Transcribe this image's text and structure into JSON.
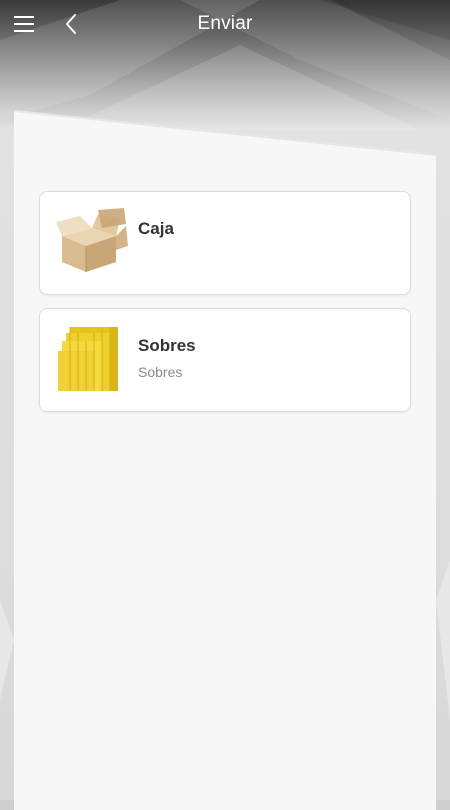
{
  "header": {
    "title": "Enviar",
    "menu_icon": "hamburger-menu-icon",
    "back_icon": "chevron-left-icon"
  },
  "items": [
    {
      "name": "Caja",
      "description": "",
      "image": "cardboard-box-image"
    },
    {
      "name": "Sobres",
      "description": "Sobres",
      "image": "padded-envelopes-image"
    }
  ],
  "colors": {
    "header_text": "#ffffff",
    "card_background": "#ffffff",
    "title_text": "#333333",
    "subtitle_text": "#8a8a8a"
  }
}
